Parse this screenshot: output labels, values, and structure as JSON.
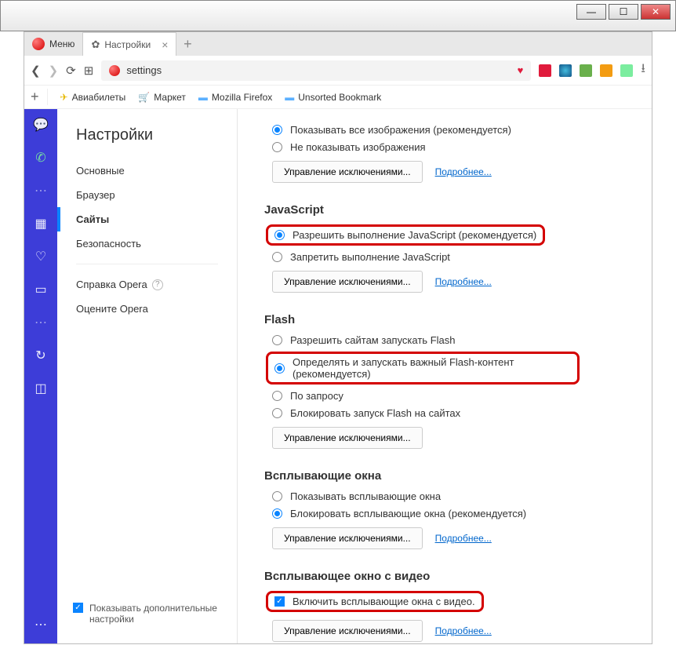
{
  "window": {
    "minimize": "—",
    "maximize": "☐",
    "close": "✕"
  },
  "tabbar": {
    "menu_label": "Меню",
    "tab_label": "Настройки",
    "tab_close": "×",
    "new_tab": "+"
  },
  "addr": {
    "url": "settings",
    "back": "❮",
    "forward": "❯",
    "reload": "⟳",
    "apps": "⊞"
  },
  "bookmarks": {
    "items": [
      {
        "icon": "✈",
        "label": "Авиабилеты"
      },
      {
        "icon": "🛒",
        "label": "Маркет"
      },
      {
        "icon": "📁",
        "label": "Mozilla Firefox"
      },
      {
        "icon": "📁",
        "label": "Unsorted Bookmark"
      }
    ]
  },
  "sidebar": {
    "title": "Настройки",
    "items": [
      {
        "label": "Основные"
      },
      {
        "label": "Браузер"
      },
      {
        "label": "Сайты"
      },
      {
        "label": "Безопасность"
      }
    ],
    "help": "Справка Opera",
    "rate": "Оцените Opera",
    "footer": "Показывать дополнительные настройки"
  },
  "sections": {
    "images": {
      "opt1": "Показывать все изображения (рекомендуется)",
      "opt2": "Не показывать изображения"
    },
    "js": {
      "title": "JavaScript",
      "opt1": "Разрешить выполнение JavaScript (рекомендуется)",
      "opt2": "Запретить выполнение JavaScript"
    },
    "flash": {
      "title": "Flash",
      "opt1": "Разрешить сайтам запускать Flash",
      "opt2": "Определять и запускать важный Flash-контент (рекомендуется)",
      "opt3": "По запросу",
      "opt4": "Блокировать запуск Flash на сайтах"
    },
    "popups": {
      "title": "Всплывающие окна",
      "opt1": "Показывать всплывающие окна",
      "opt2": "Блокировать всплывающие окна (рекомендуется)"
    },
    "video": {
      "title": "Всплывающее окно с видео",
      "opt1": "Включить всплывающие окна с видео."
    },
    "manage": "Управление исключениями...",
    "more": "Подробнее..."
  }
}
